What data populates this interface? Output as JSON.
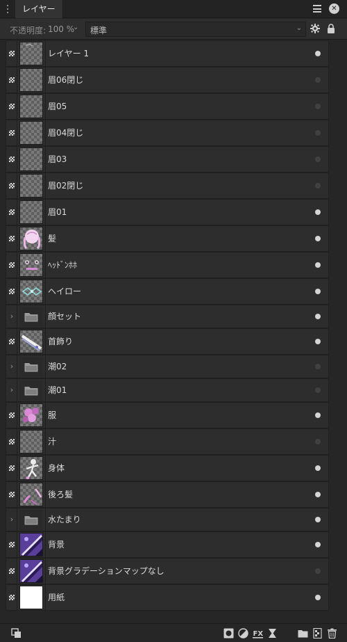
{
  "panel": {
    "tab_label": "レイヤー"
  },
  "options": {
    "opacity_label": "不透明度:",
    "opacity_value": "100 %",
    "blend_mode": "標準"
  },
  "layers": [
    {
      "name": "レイヤー 1",
      "kind": "pixel",
      "visible": true,
      "thumb": "sketch"
    },
    {
      "name": "眉06閉じ",
      "kind": "pixel",
      "visible": false,
      "thumb": "empty"
    },
    {
      "name": "眉05",
      "kind": "pixel",
      "visible": false,
      "thumb": "empty"
    },
    {
      "name": "眉04閉じ",
      "kind": "pixel",
      "visible": false,
      "thumb": "empty"
    },
    {
      "name": "眉03",
      "kind": "pixel",
      "visible": false,
      "thumb": "empty"
    },
    {
      "name": "眉02閉じ",
      "kind": "pixel",
      "visible": false,
      "thumb": "empty"
    },
    {
      "name": "眉01",
      "kind": "pixel",
      "visible": true,
      "thumb": "empty"
    },
    {
      "name": "髪",
      "kind": "pixel",
      "visible": true,
      "thumb": "hair"
    },
    {
      "name": "ﾍｯﾄﾞﾝﾎﾎ",
      "kind": "pixel",
      "visible": true,
      "thumb": "headphones"
    },
    {
      "name": "ヘイロー",
      "kind": "pixel",
      "visible": true,
      "thumb": "halo"
    },
    {
      "name": "顔セット",
      "kind": "group",
      "visible": true,
      "thumb": "folder"
    },
    {
      "name": "首飾り",
      "kind": "pixel",
      "visible": true,
      "thumb": "necklace"
    },
    {
      "name": "潮02",
      "kind": "group",
      "visible": false,
      "thumb": "folder"
    },
    {
      "name": "潮01",
      "kind": "group",
      "visible": false,
      "thumb": "folder"
    },
    {
      "name": "服",
      "kind": "pixel",
      "visible": true,
      "thumb": "clothes"
    },
    {
      "name": "汁",
      "kind": "pixel",
      "visible": false,
      "thumb": "empty"
    },
    {
      "name": "身体",
      "kind": "pixel",
      "visible": true,
      "thumb": "body"
    },
    {
      "name": "後ろ髪",
      "kind": "pixel",
      "visible": true,
      "thumb": "backhair"
    },
    {
      "name": "水たまり",
      "kind": "group",
      "visible": true,
      "thumb": "folder"
    },
    {
      "name": "背景",
      "kind": "pixel",
      "visible": true,
      "thumb": "bg"
    },
    {
      "name": "背景グラデーションマップなし",
      "kind": "pixel",
      "visible": false,
      "thumb": "bg"
    },
    {
      "name": "用紙",
      "kind": "pixel",
      "visible": true,
      "thumb": "paper"
    }
  ],
  "colors": {
    "visible_dot": "#d4d4d4",
    "hidden_dot": "#414141",
    "panel_bg": "#2d2d2d",
    "accent_pink": "#d98ad4",
    "accent_cyan": "#8fd0d0",
    "bg_purple": "#5a3f9a"
  },
  "bottom_icons": [
    "duplicate-icon",
    "mask-icon",
    "adjustment-icon",
    "fx-icon",
    "live-filter-icon",
    "add-group-icon",
    "add-pixel-layer-icon",
    "trash-icon"
  ]
}
